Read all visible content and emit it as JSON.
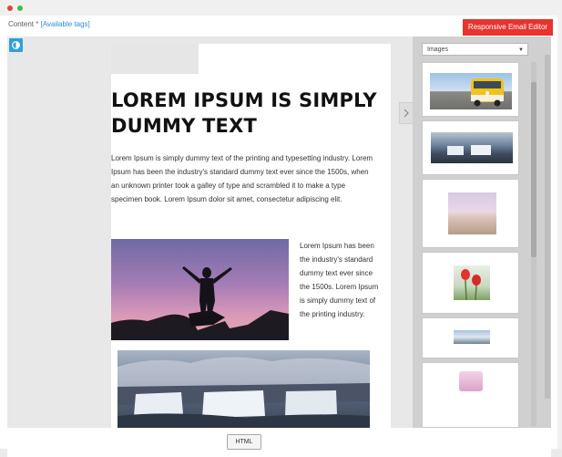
{
  "window": {
    "controls": [
      "close",
      "maximize"
    ]
  },
  "header": {
    "content_label": "Content",
    "required_mark": "*",
    "tags_link": "[Available tags]",
    "editor_button": "Responsive Email Editor"
  },
  "toolbar": {
    "toggle_icon": "contrast-icon"
  },
  "email": {
    "title": "LOREM IPSUM IS SIMPLY DUMMY TEXT",
    "paragraph": "Lorem Ipsum is simply dummy text of the printing and typesetting industry. Lorem Ipsum has been the industry's standard dummy text ever since the 1500s, when an unknown printer took a galley of type and scrambled it to make a type specimen book. Lorem Ipsum dolor sit amet, consectetur adipiscing elit.",
    "side_text": "Lorem Ipsum has been the industry's standard dummy text ever since the 1500s. Lorem Ipsum is simply dummy text of the printing industry."
  },
  "sidebar": {
    "dropdown_value": "Images",
    "thumbnails": [
      "van",
      "waterfall",
      "beach",
      "tulips",
      "panorama",
      "pink-item"
    ]
  },
  "footer": {
    "html_button": "HTML"
  },
  "colors": {
    "accent_red": "#e8332e",
    "toggle_blue": "#31a0d9"
  }
}
